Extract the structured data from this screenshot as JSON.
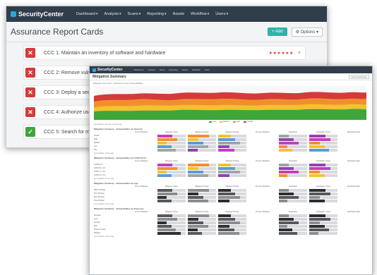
{
  "back": {
    "logo": "SecurityCenter",
    "nav": [
      "Dashboard",
      "Analysis",
      "Scans",
      "Reporting",
      "Assets",
      "Workflow",
      "Users"
    ],
    "page_title": "Assurance Report Cards",
    "add_label": "Add",
    "options_label": "Options",
    "cards": [
      {
        "label": "CCC 1: Maintain an inventory of software and hardware",
        "status": "fail"
      },
      {
        "label": "CCC 2: Remove vulner",
        "status": "fail"
      },
      {
        "label": "CCC 3: Deploy a secur",
        "status": "fail"
      },
      {
        "label": "CCC 4: Authorize users",
        "status": "fail"
      },
      {
        "label": "CCC 5: Search for mal",
        "status": "pass"
      }
    ],
    "stars": "★★★★★★",
    "close": "×"
  },
  "front": {
    "logo": "SecurityCenter",
    "nav": [
      "Dashboard",
      "Analysis",
      "Scans",
      "Reporting",
      "Assets",
      "Workflow",
      "Users"
    ],
    "title": "Mitigation Summary",
    "button": "Switch Dashboard",
    "chart_label": "Mitigation Summary - Patched Current Vulnerabilities",
    "legend": [
      {
        "name": "Low",
        "color": "#3fa63b"
      },
      {
        "name": "Medium",
        "color": "#f1c232"
      },
      {
        "name": "High",
        "color": "#f0902b"
      },
      {
        "name": "Critical",
        "color": "#d53a3a"
      }
    ],
    "chart_footer": "Last Updated: Less than a minute ago",
    "tables": [
      {
        "title": "Mitigation Summary - Vulnerabilities by Severity",
        "headers": [
          "",
          "Current Mitigated",
          "Mitigated 7 Days",
          "Mitigated 30 Days",
          "Mitigated 90 Days",
          "Previous Mitigated",
          "Exploitable",
          "Exploitable 7 Days",
          "Exploitable Ratio"
        ],
        "rows": [
          "Critical",
          "High",
          "Medium",
          "Low",
          "Info"
        ],
        "palette": "color",
        "footer": "Last Updated: 4 hours ago"
      },
      {
        "title": "Mitigation Summary - Vulnerabilities by CVSS Score",
        "headers": [
          "",
          "Current Mitigated",
          "Mitigated 7 Days",
          "Mitigated 30 Days",
          "Mitigated 90 Days",
          "Previous Mitigated",
          "Exploitable",
          "Exploitable 7 Days",
          "Exploitable Ratio"
        ],
        "rows": [
          "CVSS 10.0",
          "CVSS 9.0 - 9.9",
          "CVSS 7.0 - 8.9",
          "CVSS 4.0 - 6.9"
        ],
        "palette": "color",
        "footer": "Last Updated: 4 hours ago"
      },
      {
        "title": "Mitigation Summary - Vulnerabilities by Age",
        "headers": [
          "",
          "Current Mitigated",
          "Mitigated 7 Days",
          "Mitigated 30 Days",
          "Mitigated 90 Days",
          "Previous Mitigated",
          "Exploitable",
          "Exploitable 7 Days",
          "Exploitable Ratio"
        ],
        "rows": [
          "Within 30 Days",
          "30 to 60 Days",
          "60 to 90 Days",
          "Over 90 Days"
        ],
        "palette": "gray",
        "footer": "Last Updated: 4 hours ago"
      },
      {
        "title": "Mitigation Summary - Vulnerabilities by Exposure",
        "headers": [
          "",
          "Current Mitigated",
          "Mitigated 7 Days",
          "Mitigated 30 Days",
          "Mitigated 90 Days",
          "Previous Mitigated",
          "Exploitable",
          "Exploitable 7 Days",
          "Exploitable Ratio"
        ],
        "rows": [
          "Windows",
          "Linux",
          "Network",
          "Web",
          "Remote Access",
          "Malware"
        ],
        "palette": "gray",
        "footer": "Last Updated: 4 hours ago"
      }
    ]
  }
}
